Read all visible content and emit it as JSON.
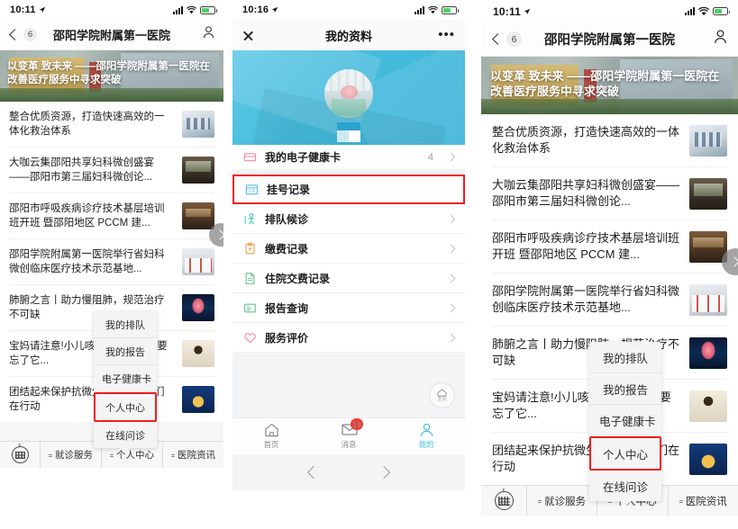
{
  "panel1": {
    "status": {
      "time": "10:11",
      "location_icon": "location-arrow-icon",
      "signal_icon": "signal-bars-icon",
      "wifi_icon": "wifi-icon",
      "battery_icon": "battery-icon"
    },
    "nav": {
      "back_icon": "chevron-left-icon",
      "badge": "6",
      "title": "邵阳学院附属第一医院",
      "profile_icon": "person-icon"
    },
    "hero": {
      "headline": "以变革 致未来 ——邵阳学院附属第一医院在改善医疗服务中寻求突破"
    },
    "news": [
      {
        "title": "整合优质资源，打造快速高效的一体化救治体系",
        "thumb": "th1"
      },
      {
        "title": "大咖云集邵阳共享妇科微创盛宴——邵阳市第三届妇科微创论...",
        "thumb": "th2"
      },
      {
        "title": "邵阳市呼吸疾病诊疗技术基层培训班开班 暨邵阳地区 PCCM 建...",
        "thumb": "th3"
      },
      {
        "title": "邵阳学院附属第一医院举行省妇科微创临床医疗技术示范基地...",
        "thumb": "th4"
      },
      {
        "title": "肺腑之言丨助力慢阻肺，规范治疗不可缺",
        "thumb": "th5"
      },
      {
        "title": "宝妈请注意!小儿咳嗽老不好，不要忘了它...",
        "thumb": "th6"
      },
      {
        "title": "团结起来保护抗微生物药物，我们在行动",
        "thumb": "th7"
      }
    ],
    "popup": {
      "items": [
        "我的排队",
        "我的报告",
        "电子健康卡",
        "个人中心",
        "在线问诊"
      ],
      "selected": "个人中心",
      "highlight_color": "#f01d1d"
    },
    "slide_arrow_icon": "chevron-right-circle-icon",
    "wxbar": {
      "keyboard_icon": "keyboard-icon",
      "items": [
        "就诊服务",
        "个人中心",
        "医院资讯"
      ]
    }
  },
  "panel2": {
    "status": {
      "time": "10:16",
      "location_icon": "location-arrow-icon",
      "signal_icon": "signal-bars-icon",
      "wifi_icon": "wifi-icon",
      "battery_icon": "battery-icon"
    },
    "nav": {
      "close_icon": "close-icon",
      "title": "我的资料",
      "more_icon": "more-dots-icon"
    },
    "banner": {
      "avatar_icon": "avatar-image",
      "accent_color": "#46bcdd"
    },
    "menu": [
      {
        "label": "我的电子健康卡",
        "icon": "health-card-icon",
        "icon_color": "#f08a9e",
        "value": "4",
        "highlighted": false
      },
      {
        "label": "挂号记录",
        "icon": "calendar-icon",
        "icon_color": "#5bb8e6",
        "value": "",
        "highlighted": true
      },
      {
        "label": "排队候诊",
        "icon": "queue-person-icon",
        "icon_color": "#4ec5c0",
        "value": "",
        "highlighted": false
      },
      {
        "label": "缴费记录",
        "icon": "clipboard-icon",
        "icon_color": "#f0a24a",
        "value": "",
        "highlighted": false
      },
      {
        "label": "住院交费记录",
        "icon": "document-icon",
        "icon_color": "#6cc58a",
        "value": "",
        "highlighted": false
      },
      {
        "label": "报告查询",
        "icon": "report-icon",
        "icon_color": "#5ec28e",
        "value": "",
        "highlighted": false
      },
      {
        "label": "服务评价",
        "icon": "heart-icon",
        "icon_color": "#f08a9e",
        "value": "",
        "highlighted": false
      }
    ],
    "home_fab": {
      "icon": "home-icon",
      "label": "主页"
    },
    "tabbar": [
      {
        "label": "首页",
        "icon": "home-icon",
        "active": false,
        "badge": ""
      },
      {
        "label": "消息",
        "icon": "envelope-icon",
        "active": false,
        "badge": "13"
      },
      {
        "label": "我的",
        "icon": "person-icon",
        "active": true,
        "badge": ""
      }
    ],
    "pager": {
      "prev_icon": "chevron-left-icon",
      "next_icon": "chevron-right-icon"
    },
    "active_color": "#4ec0d9",
    "highlight_color": "#f01d1d"
  },
  "panel3": {
    "status": {
      "time": "10:11",
      "location_icon": "location-arrow-icon",
      "signal_icon": "signal-bars-icon",
      "wifi_icon": "wifi-icon",
      "battery_icon": "battery-icon"
    },
    "nav": {
      "back_icon": "chevron-left-icon",
      "badge": "6",
      "title": "邵阳学院附属第一医院",
      "profile_icon": "person-icon"
    },
    "hero": {
      "headline": "以变革 致未来 ——邵阳学院附属第一医院在改善医疗服务中寻求突破"
    },
    "news": [
      {
        "title": "整合优质资源，打造快速高效的一体化救治体系",
        "thumb": "th1"
      },
      {
        "title": "大咖云集邵阳共享妇科微创盛宴——邵阳市第三届妇科微创论...",
        "thumb": "th2"
      },
      {
        "title": "邵阳市呼吸疾病诊疗技术基层培训班开班 暨邵阳地区 PCCM 建...",
        "thumb": "th3"
      },
      {
        "title": "邵阳学院附属第一医院举行省妇科微创临床医疗技术示范基地...",
        "thumb": "th4"
      },
      {
        "title": "肺腑之言丨助力慢阻肺，规范治疗不可缺",
        "thumb": "th5"
      },
      {
        "title": "宝妈请注意!小儿咳嗽老不好，不要忘了它...",
        "thumb": "th6"
      },
      {
        "title": "团结起来保护抗微生物药物，我们在行动",
        "thumb": "th7"
      }
    ],
    "popup": {
      "items": [
        "我的排队",
        "我的报告",
        "电子健康卡",
        "个人中心",
        "在线问诊"
      ],
      "selected": "个人中心",
      "highlight_color": "#f01d1d"
    },
    "slide_arrow_icon": "chevron-right-circle-icon",
    "wxbar": {
      "keyboard_icon": "keyboard-icon",
      "items": [
        "就诊服务",
        "个人中心",
        "医院资讯"
      ]
    }
  }
}
